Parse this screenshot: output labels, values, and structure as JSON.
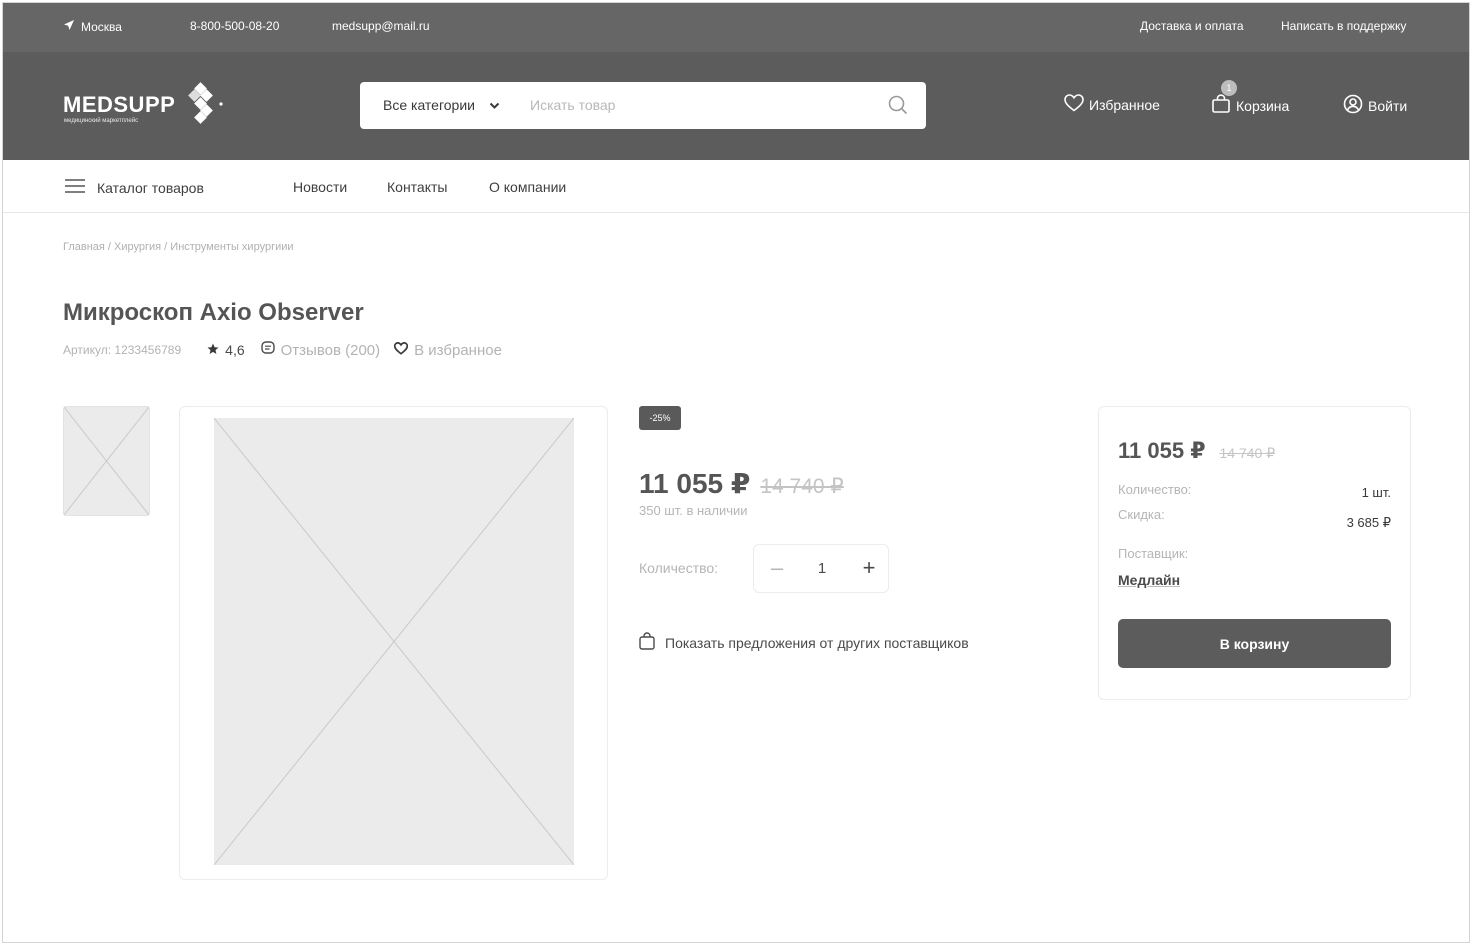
{
  "topbar": {
    "city": "Москва",
    "phone": "8-800-500-08-20",
    "email": "medsupp@mail.ru",
    "delivery": "Доставка и оплата",
    "support": "Написать в поддержку"
  },
  "header": {
    "logo_word": "MEDSUPP",
    "logo_sub": "медицинский маркетплейс",
    "category_select": "Все категории",
    "search_placeholder": "Искать товар",
    "favorites": "Избранное",
    "cart": "Корзина",
    "cart_count": "1",
    "login": "Войти"
  },
  "nav": {
    "catalog": "Каталог товаров",
    "links": [
      "Новости",
      "Контакты",
      "О компании"
    ]
  },
  "breadcrumb": "Главная / Хирургия / Инструменты хирургиии",
  "product": {
    "title": "Микроскоп Axio Observer",
    "article": "Артикул: 1233456789",
    "rating": "4,6",
    "reviews": "Отзывов (200)",
    "add_to_fav": "В избранное",
    "discount": "-25%",
    "price": "11 055 ₽",
    "old_price": "14 740 ₽",
    "stock": "350 шт. в наличии",
    "quantity_label": "Количество:",
    "quantity": "1",
    "other_offers": "Показать предложения от других поставщиков"
  },
  "card": {
    "price": "11 055 ₽",
    "old_price": "14 740 ₽",
    "quantity_label": "Количество:",
    "quantity_value": "1 шт.",
    "discount_label": "Скидка:",
    "discount_value": "3 685 ₽",
    "supplier_label": "Поставщик:",
    "supplier": "Медлайн",
    "button": "В корзину"
  },
  "icons": {
    "city": "location-arrow-icon",
    "search": "search-icon",
    "favorites": "heart-icon",
    "cart": "shopping-bag-icon",
    "login": "user-circle-icon",
    "menu": "hamburger-menu-icon",
    "rating": "star-icon",
    "reviews": "comment-icon",
    "placeholder": "image-placeholder-icon"
  }
}
